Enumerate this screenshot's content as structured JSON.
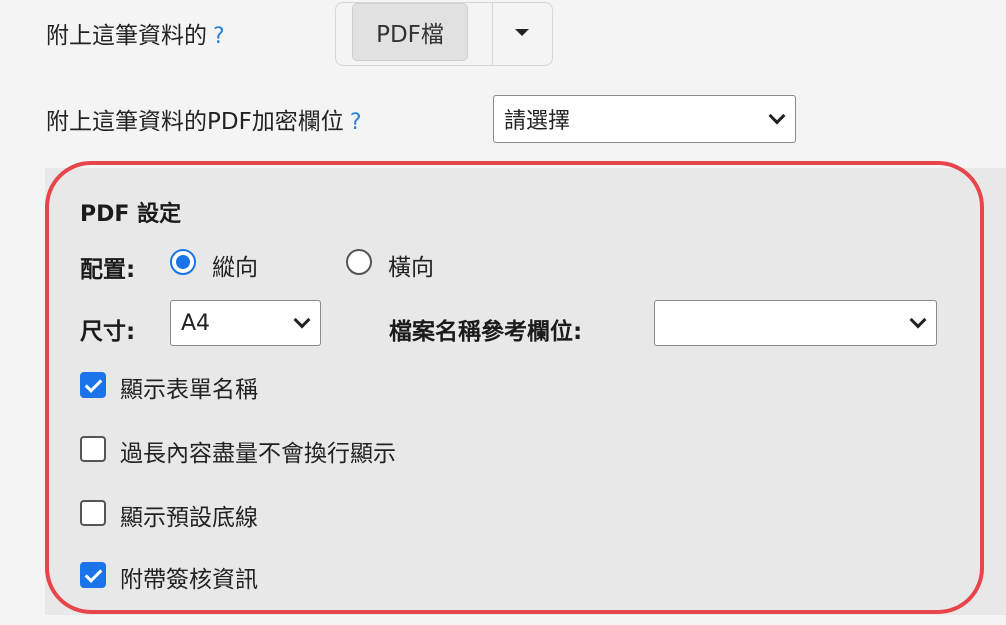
{
  "attach": {
    "label": "附上這筆資料的",
    "help": "?",
    "button_label": "PDF檔"
  },
  "encrypt": {
    "label": "附上這筆資料的PDF加密欄位",
    "help": "?",
    "selected": "請選擇"
  },
  "pdf_settings": {
    "title": "PDF 設定",
    "orientation": {
      "label": "配置:",
      "options": [
        "縱向",
        "橫向"
      ],
      "selected": "縱向"
    },
    "size": {
      "label": "尺寸:",
      "selected": "A4"
    },
    "filename_field": {
      "label": "檔案名稱參考欄位:",
      "selected": ""
    },
    "checkboxes": [
      {
        "label": "顯示表單名稱",
        "checked": true
      },
      {
        "label": "過長內容盡量不會換行顯示",
        "checked": false
      },
      {
        "label": "顯示預設底線",
        "checked": false
      },
      {
        "label": "附帶簽核資訊",
        "checked": true
      }
    ]
  },
  "colors": {
    "accent": "#1a73e8",
    "help": "#2a83d8",
    "highlight": "#e8454a",
    "panel_bg": "#e8e8e8"
  }
}
